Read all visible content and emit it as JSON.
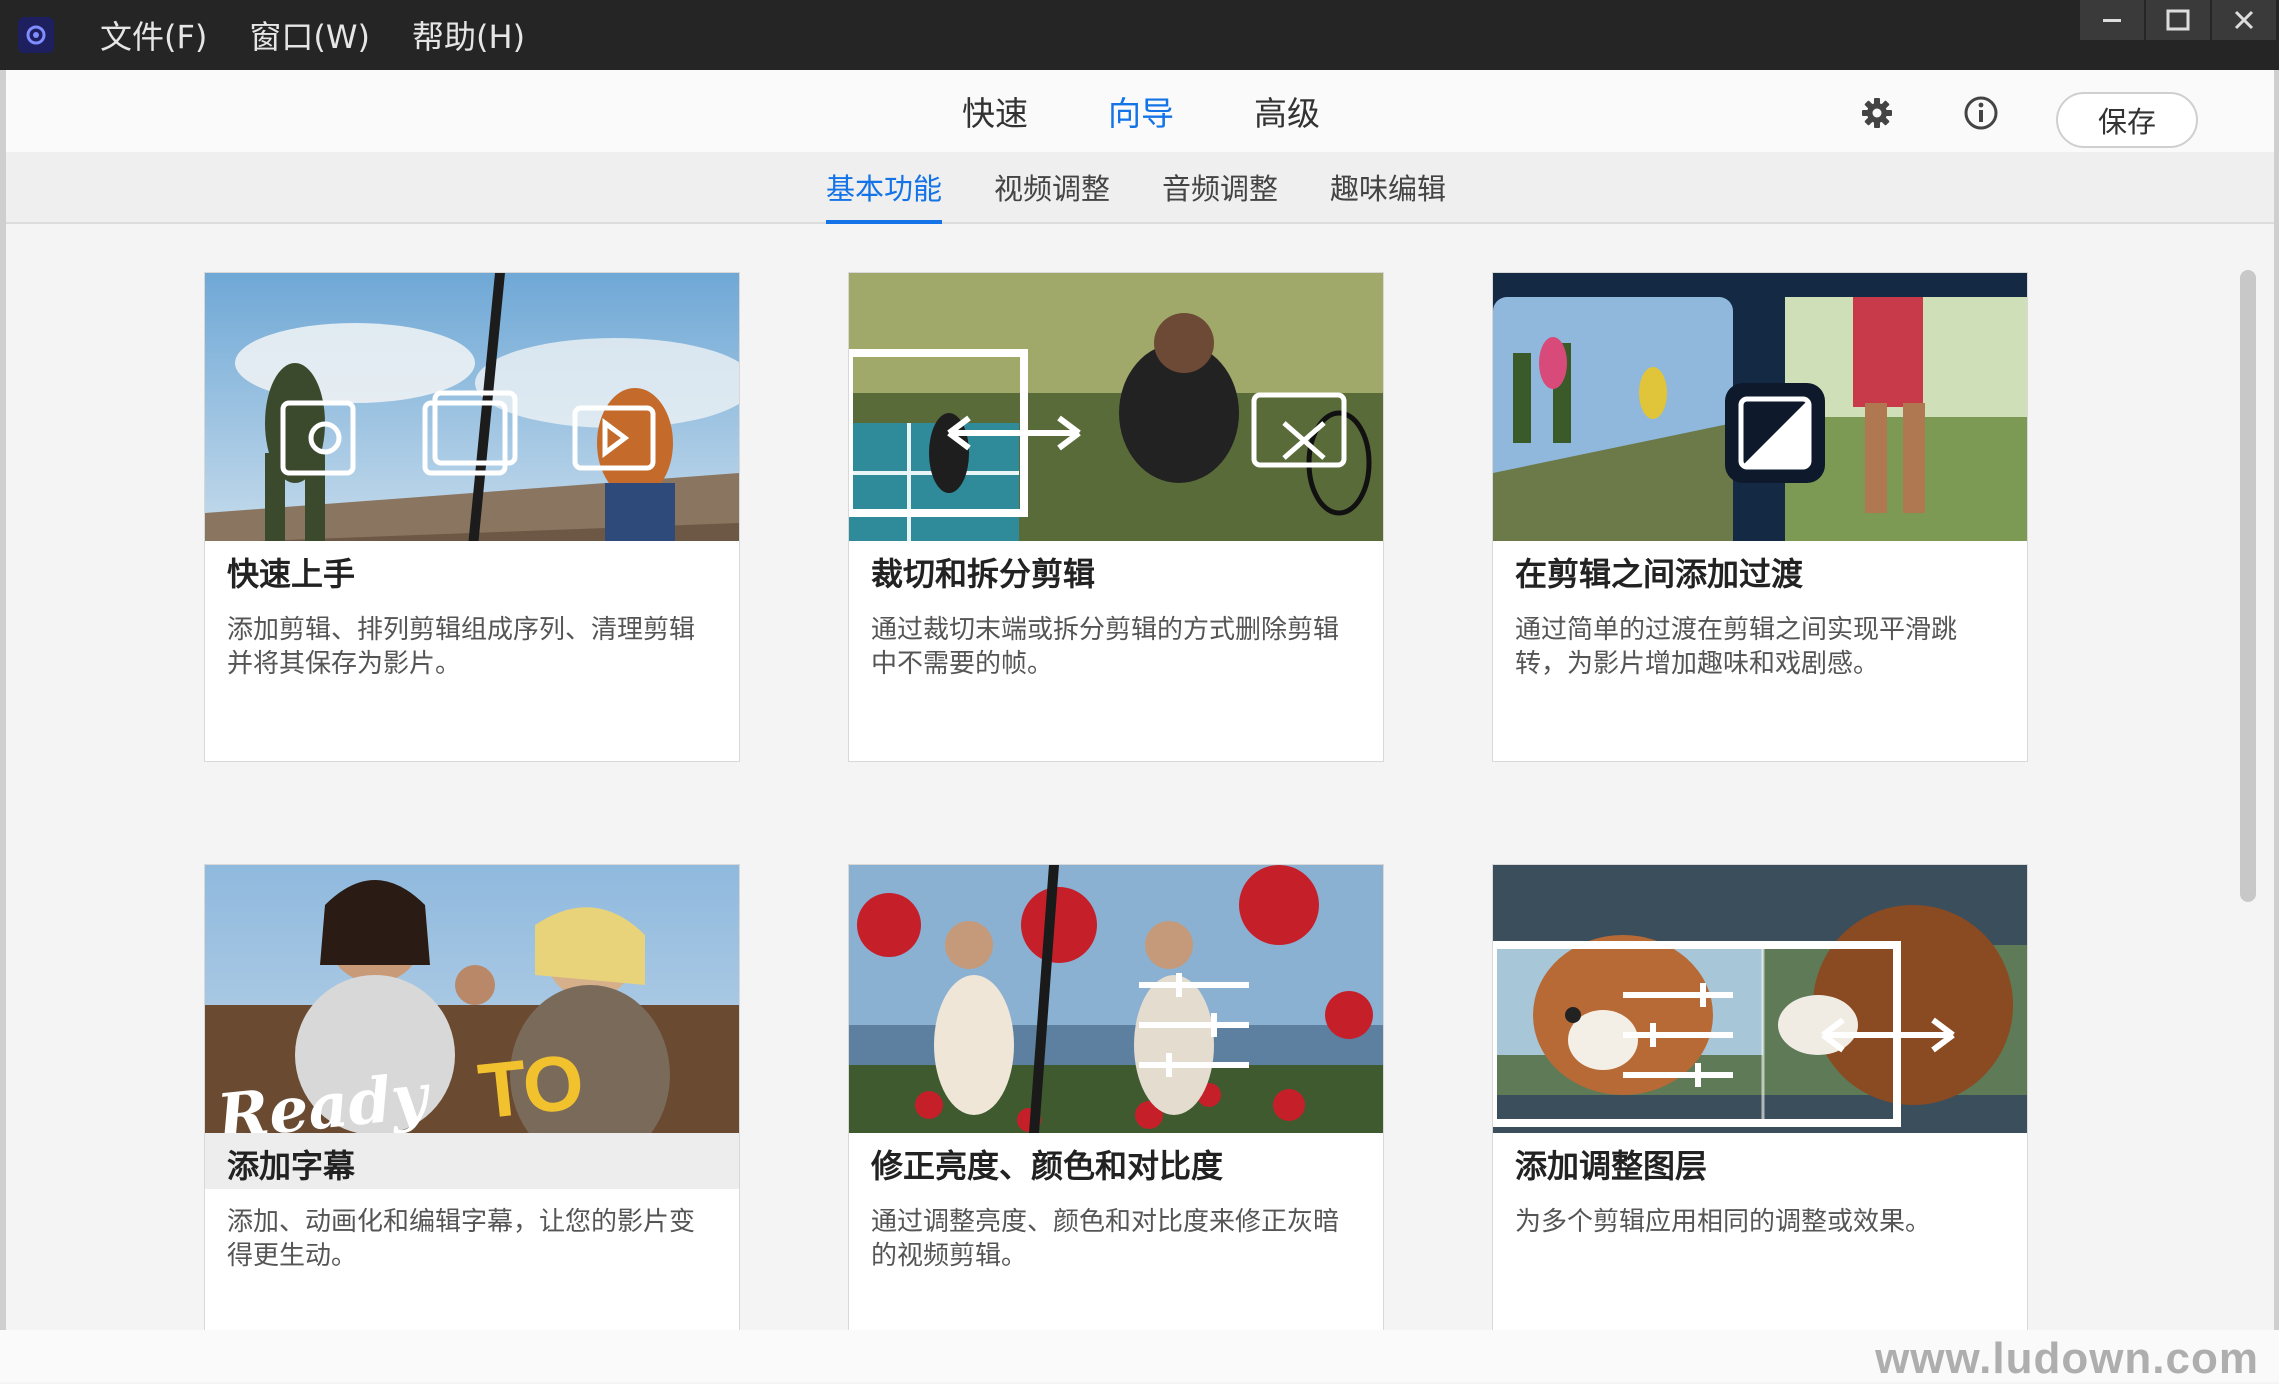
{
  "menu": {
    "file": "文件(F)",
    "window": "窗口(W)",
    "help": "帮助(H)"
  },
  "modes": {
    "quick": "快速",
    "guided": "向导",
    "expert": "高级"
  },
  "toolbar": {
    "save_label": "保存"
  },
  "subtabs": [
    "基本功能",
    "视频调整",
    "音频调整",
    "趣味编辑"
  ],
  "cards": [
    {
      "title": "快速上手",
      "desc": "添加剪辑、排列剪辑组成序列、清理剪辑并将其保存为影片。"
    },
    {
      "title": "裁切和拆分剪辑",
      "desc": "通过裁切末端或拆分剪辑的方式删除剪辑中不需要的帧。"
    },
    {
      "title": "在剪辑之间添加过渡",
      "desc": "通过简单的过渡在剪辑之间实现平滑跳转，为影片增加趣味和戏剧感。"
    },
    {
      "title": "添加字幕",
      "desc": "添加、动画化和编辑字幕，让您的影片变得更生动。",
      "overlay_text_1": "Ready",
      "overlay_text_2": "TO RIDE!"
    },
    {
      "title": "修正亮度、颜色和对比度",
      "desc": "通过调整亮度、颜色和对比度来修正灰暗的视频剪辑。"
    },
    {
      "title": "添加调整图层",
      "desc": "为多个剪辑应用相同的调整或效果。"
    }
  ],
  "watermark": "www.ludown.com",
  "colors": {
    "accent": "#1473e6",
    "titlebar": "#252525"
  }
}
